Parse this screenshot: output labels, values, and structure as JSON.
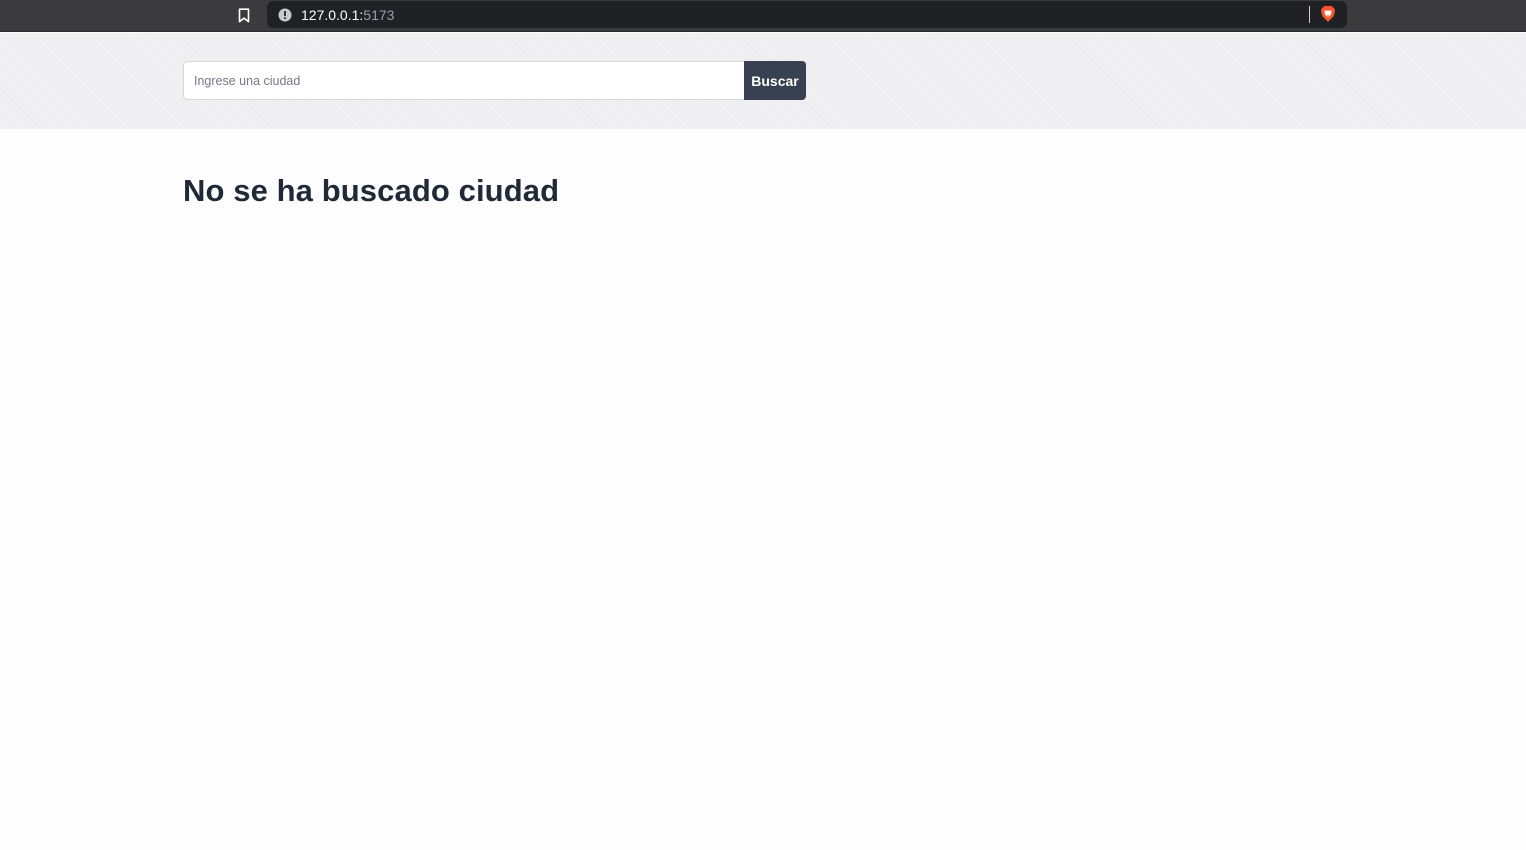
{
  "browser": {
    "url_host": "127.0.0.1:",
    "url_port": "5173",
    "icons": {
      "bookmark": "bookmark-icon",
      "site_info": "info-icon",
      "brave": "brave-lion-icon"
    }
  },
  "search": {
    "placeholder": "Ingrese una ciudad",
    "value": "",
    "button_label": "Buscar"
  },
  "main": {
    "status_message": "No se ha buscado ciudad"
  },
  "colors": {
    "button_bg": "#374151",
    "heading": "#1f2937",
    "header_bg": "#f1f0f2",
    "page_bg": "#fdfdfd",
    "brave_orange": "#fb542b"
  }
}
